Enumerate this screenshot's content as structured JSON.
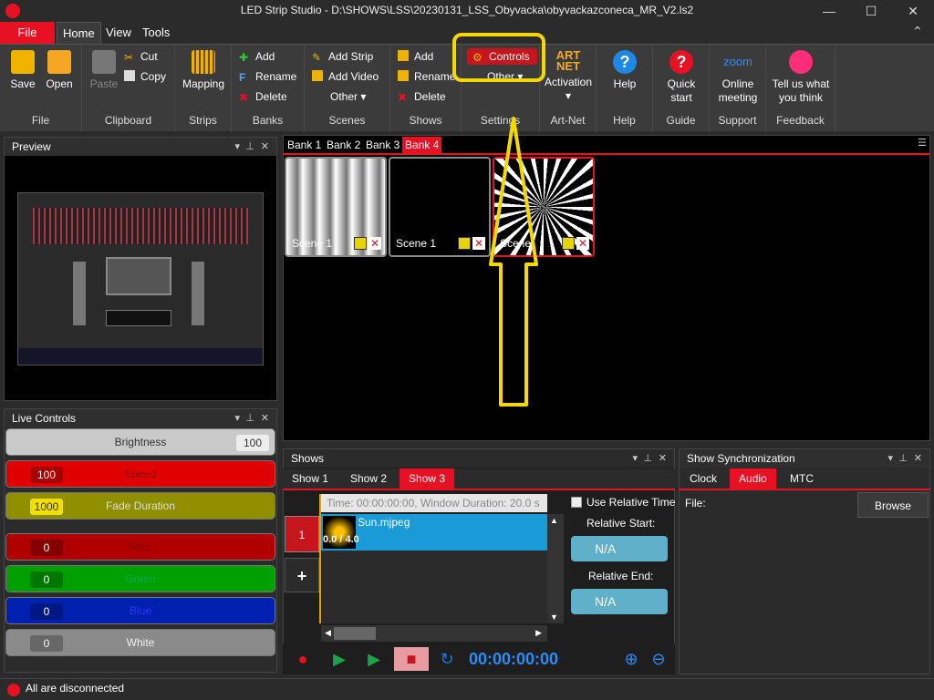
{
  "window": {
    "title": "LED Strip Studio - D:\\SHOWS\\LSS\\20230131_LSS_Obyvacka\\obyvackazconeca_MR_V2.ls2",
    "min": "—",
    "max": "☐",
    "close": "✕"
  },
  "menu": {
    "file": "File",
    "tabs": [
      "Home",
      "View",
      "Tools"
    ]
  },
  "ribbon": {
    "file": {
      "save": "Save",
      "open": "Open",
      "label": "File"
    },
    "clipboard": {
      "paste": "Paste",
      "cut": "Cut",
      "copy": "Copy",
      "label": "Clipboard"
    },
    "strips": {
      "mapping": "Mapping",
      "label": "Strips"
    },
    "banks": {
      "add": "Add",
      "rename": "Rename",
      "delete": "Delete",
      "label": "Banks"
    },
    "scenes": {
      "add_strip": "Add Strip",
      "add_video": "Add Video",
      "other": "Other ▾",
      "label": "Scenes"
    },
    "shows": {
      "add": "Add",
      "rename": "Rename",
      "delete": "Delete",
      "label": "Shows"
    },
    "settings": {
      "controls": "Controls",
      "other": "Other ▾",
      "label": "Settings"
    },
    "artnet": {
      "activation": "Activation",
      "arrow": "▾",
      "label": "Art-Net",
      "logo_top": "ART",
      "logo_bottom": "NET"
    },
    "help": {
      "help": "Help",
      "label": "Help"
    },
    "guide": {
      "quick_start": "Quick start",
      "label": "Guide"
    },
    "support": {
      "online_meeting": "Online meeting",
      "label": "Support",
      "zoom": "zoom"
    },
    "feedback": {
      "tell_us": "Tell us what you think",
      "label": "Feedback"
    }
  },
  "preview": {
    "title": "Preview"
  },
  "live_controls": {
    "title": "Live Controls",
    "sliders": [
      {
        "label": "Brightness",
        "value": "100",
        "color": "#c9c9c9"
      },
      {
        "label": "Speed",
        "value": "100",
        "color": "#e00000"
      },
      {
        "label": "Fade Duration",
        "value": "1000",
        "color": "#8f8f00"
      },
      {
        "label": "Red",
        "value": "0",
        "color": "#b00000"
      },
      {
        "label": "Green",
        "value": "0",
        "color": "#00a000"
      },
      {
        "label": "Blue",
        "value": "0",
        "color": "#0020b0"
      },
      {
        "label": "White",
        "value": "0",
        "color": "#8a8a8a"
      }
    ]
  },
  "banks": {
    "tabs": [
      "Bank 1",
      "Bank 2",
      "Bank 3",
      "Bank 4"
    ],
    "active": "Bank 4"
  },
  "scenes": [
    {
      "name": "Scene 1",
      "thumb": "vertical-gradient-stripes"
    },
    {
      "name": "Scene 1",
      "thumb": "black"
    },
    {
      "name": "Scene",
      "thumb": "radial-starburst"
    }
  ],
  "shows": {
    "title": "Shows",
    "tabs": [
      "Show 1",
      "Show 2",
      "Show 3"
    ],
    "active": "Show 3",
    "time_header": "Time: 00:00:00:00,   Window Duration: 20.0 s",
    "clip": {
      "name": "Sun.mjpeg",
      "range": "0.0 / 4.0"
    },
    "track_number": "1",
    "add_track": "+",
    "use_relative_time": "Use Relative Time",
    "relative_start_label": "Relative Start:",
    "relative_start_value": "N/A",
    "relative_end_label": "Relative End:",
    "relative_end_value": "N/A",
    "timecode": "00:00:00:00"
  },
  "show_sync": {
    "title": "Show Synchronization",
    "tabs": [
      "Clock",
      "Audio",
      "MTC"
    ],
    "active": "Audio",
    "file_label": "File:",
    "browse": "Browse"
  },
  "status": {
    "text": "All are disconnected",
    "indicator_color": "#e81123"
  },
  "annotation": {
    "color": "#f5d800"
  }
}
